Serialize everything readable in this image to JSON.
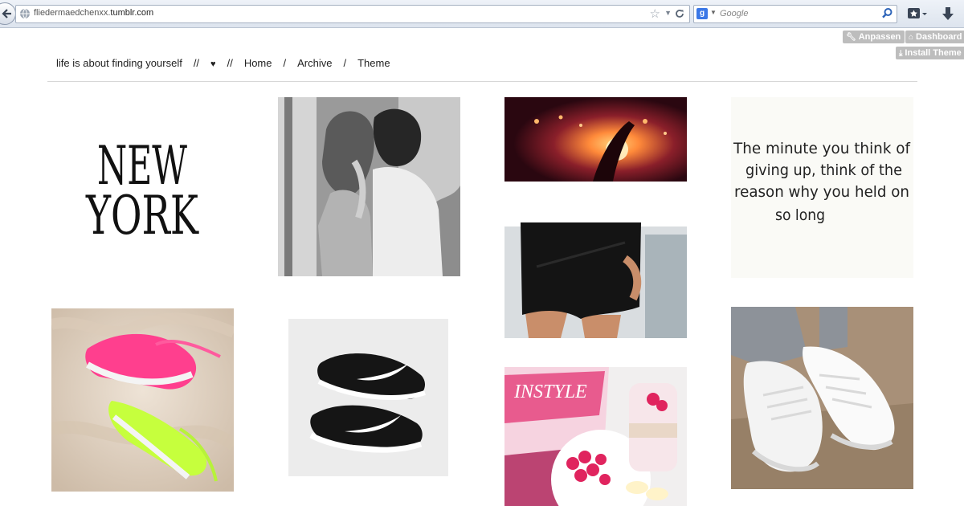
{
  "browser": {
    "url_prefix": "fliedermaedchenxx.",
    "url_domain": "tumblr.com",
    "search_engine_glyph": "g",
    "search_placeholder": "Google"
  },
  "tumblr_controls": {
    "customize_label": "Anpassen",
    "dashboard_label": "Dashboard",
    "install_label": "Install Theme"
  },
  "nav": {
    "title": "life is about finding yourself",
    "sep1": "//",
    "heart": "♥",
    "sep2": "//",
    "home": "Home",
    "slash1": "/",
    "archive": "Archive",
    "slash2": "/",
    "theme": "Theme"
  },
  "posts": {
    "newyork_line1": "NEW",
    "newyork_line2": "YORK",
    "quote_line1": "The minute you think of",
    "quote_line2": "giving up, think of the",
    "quote_line3": "reason why you held on",
    "quote_line4": "so long",
    "magazine_text": "INSTYLE"
  },
  "colors": {
    "accent_pink": "#ff3f8e",
    "accent_lime": "#c6ff3d",
    "control_gray": "#bdbdbd"
  }
}
